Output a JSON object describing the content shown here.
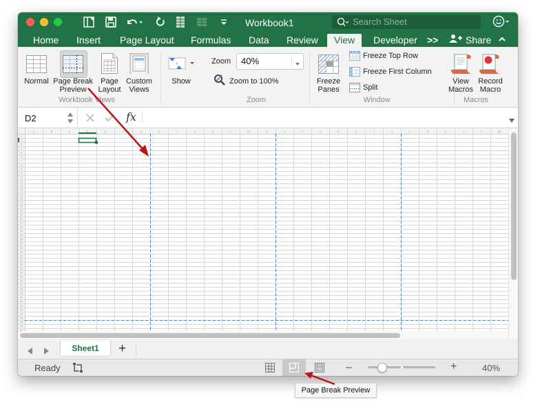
{
  "window": {
    "title": "Workbook1",
    "search_placeholder": "Search Sheet"
  },
  "ribbon_tabs": [
    {
      "label": "Home",
      "active": false
    },
    {
      "label": "Insert",
      "active": false
    },
    {
      "label": "Page Layout",
      "active": false
    },
    {
      "label": "Formulas",
      "active": false
    },
    {
      "label": "Data",
      "active": false
    },
    {
      "label": "Review",
      "active": false
    },
    {
      "label": "View",
      "active": true
    },
    {
      "label": "Developer",
      "active": false
    }
  ],
  "more_tabs_label": ">>",
  "share_label": "Share",
  "ribbon": {
    "workbook_views": {
      "group_label": "Workbook Views",
      "normal": "Normal",
      "page_break_preview_1": "Page Break",
      "page_break_preview_2": "Preview",
      "page_layout_1": "Page",
      "page_layout_2": "Layout",
      "custom_views_1": "Custom",
      "custom_views_2": "Views"
    },
    "show": {
      "label": "Show"
    },
    "zoom": {
      "group_label": "Zoom",
      "zoom_label": "Zoom",
      "zoom_value": "40%",
      "zoom_to_100": "Zoom to 100%"
    },
    "window": {
      "group_label": "Window",
      "freeze_panes_1": "Freeze",
      "freeze_panes_2": "Panes",
      "freeze_top_row": "Freeze Top Row",
      "freeze_first_column": "Freeze First Column",
      "split": "Split"
    },
    "macros": {
      "group_label": "Macros",
      "view_macros_1": "View",
      "view_macros_2": "Macros",
      "record_macro_1": "Record",
      "record_macro_2": "Macro"
    }
  },
  "formula_bar": {
    "name_box": "D2",
    "fx_label": "fx",
    "formula_value": ""
  },
  "grid": {
    "columns": [
      "A",
      "B",
      "C",
      "D",
      "E",
      "F",
      "G",
      "H",
      "I",
      "J",
      "K",
      "L",
      "M",
      "N",
      "O",
      "P",
      "Q",
      "R",
      "S",
      "T",
      "U",
      "V",
      "W",
      "X",
      "Y",
      "Z",
      "AA"
    ],
    "row_count": 48,
    "selected_cell": "D2",
    "page_break_after_columns": [
      "G",
      "N",
      "U"
    ],
    "page_break_after_row": 45
  },
  "sheets": [
    {
      "label": "Sheet1",
      "active": true
    }
  ],
  "add_sheet_label": "+",
  "status": {
    "ready": "Ready",
    "zoom_percent": "40%",
    "zoom_slider_fraction": 0.09,
    "active_view": "page-break-preview"
  },
  "tooltip": "Page Break Preview",
  "colors": {
    "excel_green": "#217346",
    "page_break_blue": "#4a7fd4",
    "annotation_red": "#b8151b"
  }
}
